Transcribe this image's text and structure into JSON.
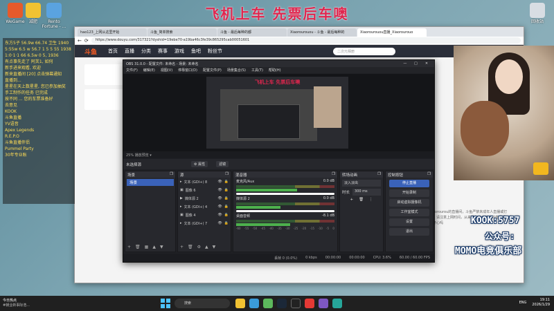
{
  "banner": "飞机上车   先票后车噢",
  "desktop_icons": [
    {
      "label": "WeGame",
      "color": "#e55a2b"
    },
    {
      "label": "减肥",
      "color": "#f1c232"
    },
    {
      "label": "Rento Fortune - ...",
      "color": "#5aa3e0"
    }
  ],
  "recycle_bin": "回收站",
  "browser": {
    "tabs": [
      "hao123_上网从这里开始",
      "斗鱼_简单搜索",
      "斗鱼 - 最后每种的都",
      "Xiaorourouou - 斗鱼 - 最后每种的",
      "Xiaorourouou直播_Xiaorourouo"
    ],
    "url": "https://www.douyu.com/317321?dyshid=19ebe70-a19ba46c3fe39c865295cab00051601",
    "site": {
      "logo": "斗鱼",
      "nav": [
        "首页",
        "直播",
        "分类",
        "赛事",
        "游戏",
        "鱼吧",
        "粉丝节"
      ],
      "search_placeholder": "二次元相册",
      "right_text": "Xiaorourou的直播间，斗鱼严禁未成年人直播或打赏，请注意上网时间，从来没有这么快乐的直播间，今天开心吗"
    }
  },
  "chat_lines": [
    "东方5子 56.9w 66.74 卫生 1940",
    "5:55w 6.5 w 56.7 1 5 5 55 1938",
    "1:0·1·1 66 6.5w 0 5, 1936",
    "有点事先走了 阿芙1, 如何",
    "新手进来观看, 欢迎",
    "新来直播间 [20] 点击弹幕通知",
    "直播到...",
    "星星在天上数星星, 您已参加抽奖",
    "手工制作的任务 已完成",
    "按不同 ... 您的车票准备好",
    "去意见",
    "KOOK",
    "斗鱼直播",
    "YV语音",
    "Apex Legends",
    "R.E.P.O",
    "斗鱼直播伴侣",
    "Pummel Party",
    "30年专业账"
  ],
  "obs": {
    "title": "OBS 31.0.0 - 配置文件: 未命名 - 场景: 未命名",
    "menu": [
      "文件(F)",
      "编辑(E)",
      "视图(V)",
      "停靠窗口(D)",
      "配置文件(P)",
      "场景集合(S)",
      "工具(T)",
      "帮助(H)"
    ],
    "preview_title": "飞机上车   先票后车噢",
    "zoom": "25%   播放预览 ▾",
    "no_source": "未选择源",
    "props_btn": "⚙ 属性",
    "filters_btn": "滤镜",
    "docks": {
      "scenes": "场景",
      "sources": "源",
      "mixer": "混音器",
      "transitions": "转场动画",
      "controls": "控制按钮"
    },
    "scene_item": "场景",
    "sources": [
      "文本 (GDI+) 8",
      "图像 6",
      "媒体源 2",
      "文本 (GDI+) 4",
      "图像 4",
      "文本 (GDI+) 7"
    ],
    "mixer_channels": [
      {
        "name": "麦克风/Aux",
        "db": "0.0 dB",
        "level": 0.62
      },
      {
        "name": "媒体源 2",
        "db": "0.0 dB",
        "level": 0.45
      },
      {
        "name": "桌面音频",
        "db": "-8.1 dB",
        "level": 0.55
      }
    ],
    "mixer_scale": [
      "-60",
      "-55",
      "-50",
      "-45",
      "-40",
      "-35",
      "-30",
      "-25",
      "-20",
      "-15",
      "-10",
      "-5",
      "0"
    ],
    "transition": "淡入淡出",
    "duration_label": "时长",
    "duration_value": "300 ms",
    "controls": [
      "停止直播",
      "开始录制",
      "启动虚拟摄像机",
      "工作室模式",
      "设置",
      "退出"
    ],
    "status": {
      "dropped": "丢帧 0 (0.0%)",
      "bitrate": "0 kbps",
      "stream_time": "00:00:00",
      "rec_time": "00:00:00",
      "cpu": "CPU: 3.6%",
      "fps": "60.00 / 60.00 FPS"
    }
  },
  "overlay": {
    "kook": "KOOK:5757",
    "gzh": "公众号:",
    "club": "MOMO电竞俱乐部"
  },
  "taskbar": {
    "news_title": "今日热点",
    "news_sub": "#朝业新事际浩...",
    "search": "搜索",
    "lang": "ENG",
    "time": "19:11",
    "date": "2026/1/29"
  }
}
